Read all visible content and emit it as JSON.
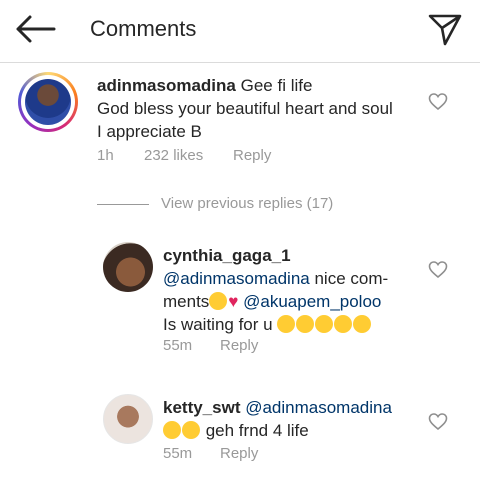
{
  "header": {
    "title": "Comments",
    "back_icon": "arrow-left-icon",
    "send_icon": "paper-plane-icon"
  },
  "comments": [
    {
      "username": "adinmasomadina",
      "text_line1": "Gee fi life",
      "text_line2": "God bless your beautiful heart and soul",
      "text_line3": "I appreciate B",
      "time": "1h",
      "likes": "232 likes",
      "reply": "Reply"
    }
  ],
  "view_previous": "View previous replies (17)",
  "replies": [
    {
      "username": "cynthia_gaga_1",
      "mention": "@adinmasomadina",
      "text_a": " nice com-",
      "text_b": "ments",
      "mention2": "@akuapem_poloo",
      "text_c": "Is waiting for u",
      "time": "55m",
      "reply": "Reply"
    },
    {
      "username": "ketty_swt",
      "mention": "@adinmasomadina",
      "text": " geh frnd 4 life",
      "time": "55m",
      "reply": "Reply"
    }
  ]
}
